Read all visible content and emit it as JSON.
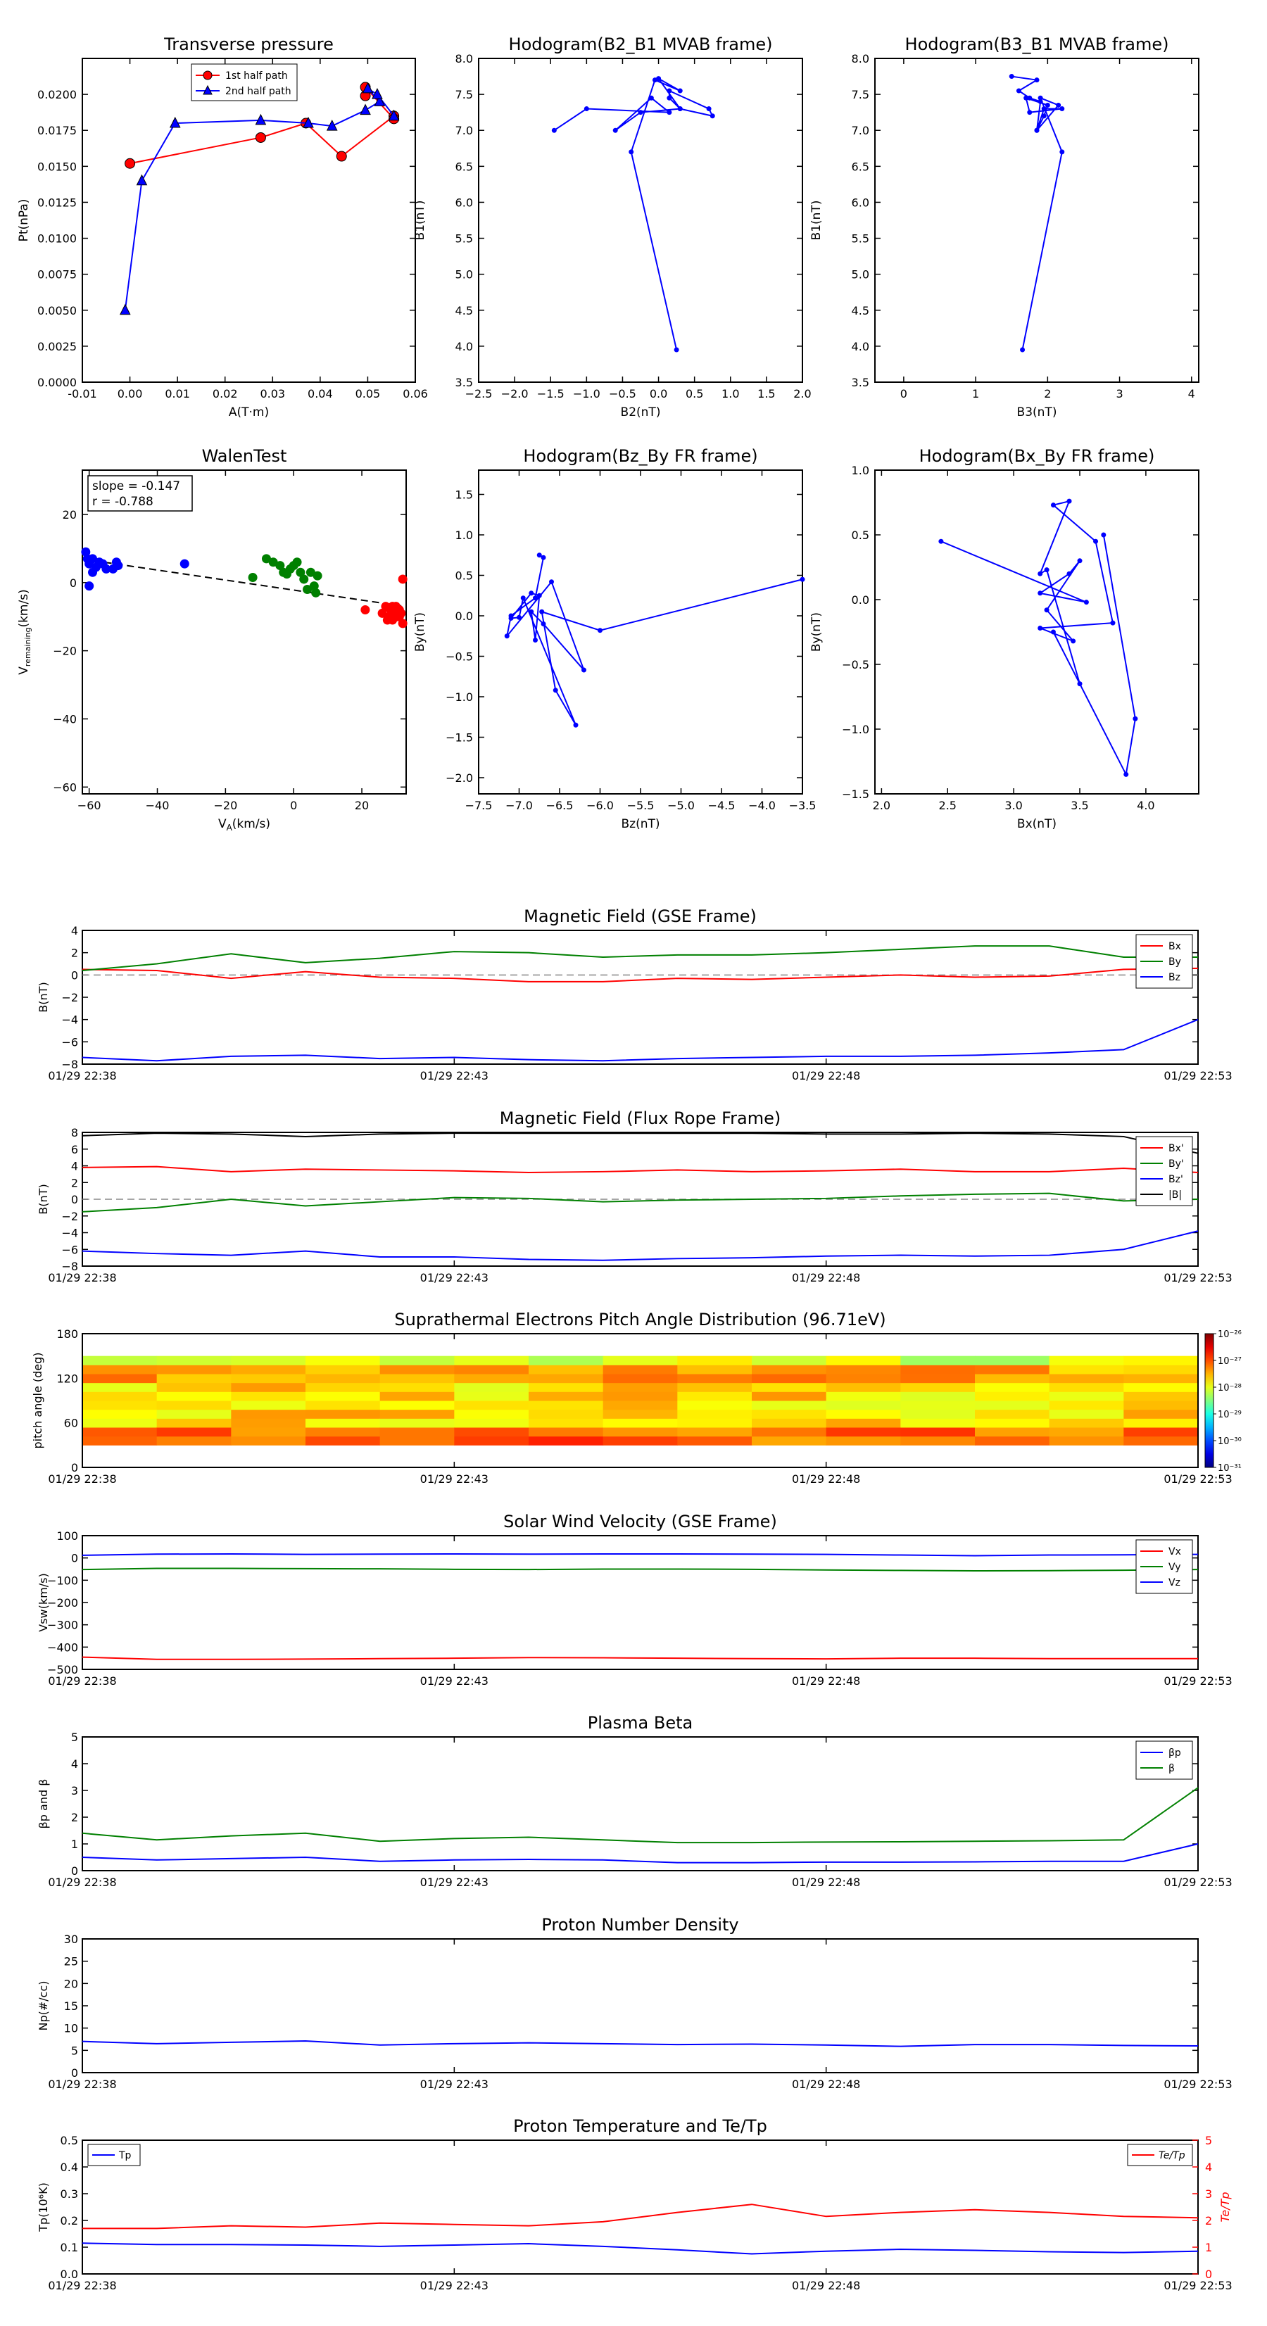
{
  "chart_data": [
    {
      "id": "pt",
      "type": "scatter",
      "title": "Transverse pressure",
      "xlabel": "A(T·m)",
      "ylabel": "Pt(nPa)",
      "xlim": [
        -0.01,
        0.06
      ],
      "ylim": [
        0,
        0.0225
      ],
      "xticks": [
        "-0.01",
        "0.00",
        "0.01",
        "0.02",
        "0.03",
        "0.04",
        "0.05",
        "0.06"
      ],
      "yticks": [
        "0.0000",
        "0.0025",
        "0.0050",
        "0.0075",
        "0.0100",
        "0.0125",
        "0.0150",
        "0.0175",
        "0.0200"
      ],
      "legend": "top-center",
      "series": [
        {
          "name": "1st half path",
          "color": "#ff0000",
          "marker": "circle",
          "x": [
            0.0,
            0.0275,
            0.037,
            0.0445,
            0.0555,
            0.0555,
            0.0495,
            0.0495
          ],
          "y": [
            0.0152,
            0.017,
            0.018,
            0.0157,
            0.0185,
            0.0183,
            0.0205,
            0.0199
          ]
        },
        {
          "name": "2nd half path",
          "color": "#0000ff",
          "marker": "triangle",
          "x": [
            -0.001,
            0.0025,
            0.0095,
            0.0275,
            0.0375,
            0.0425,
            0.0495,
            0.0525,
            0.05,
            0.052,
            0.0555
          ],
          "y": [
            0.005,
            0.014,
            0.018,
            0.0182,
            0.018,
            0.0178,
            0.0189,
            0.0195,
            0.0204,
            0.02,
            0.0185
          ]
        }
      ]
    },
    {
      "id": "hodo21",
      "type": "line",
      "title": "Hodogram(B2_B1 MVAB frame)",
      "xlabel": "B2(nT)",
      "ylabel": "B1(nT)",
      "xlim": [
        -2.5,
        2.0
      ],
      "ylim": [
        3.5,
        8.0
      ],
      "xticks": [
        "−2.5",
        "−2.0",
        "−1.5",
        "−1.0",
        "−0.5",
        "0.0",
        "0.5",
        "1.0",
        "1.5",
        "2.0"
      ],
      "yticks": [
        "3.5",
        "4.0",
        "4.5",
        "5.0",
        "5.5",
        "6.0",
        "6.5",
        "7.0",
        "7.5",
        "8.0"
      ],
      "series": [
        {
          "color": "#0000ff",
          "x": [
            -1.45,
            -1.0,
            0.15,
            -0.1,
            -0.6,
            -0.25,
            0.3,
            0.15,
            0.15,
            0.7,
            0.75,
            0.3,
            0.0,
            0.3,
            -0.05,
            -0.38,
            0.25
          ],
          "y": [
            7.0,
            7.3,
            7.25,
            7.45,
            7.0,
            7.25,
            7.3,
            7.45,
            7.55,
            7.3,
            7.2,
            7.3,
            7.72,
            7.55,
            7.7,
            6.7,
            3.95
          ]
        }
      ]
    },
    {
      "id": "hodo31",
      "type": "line",
      "title": "Hodogram(B3_B1 MVAB frame)",
      "xlabel": "B3(nT)",
      "ylabel": "B1(nT)",
      "xlim": [
        -0.4,
        4.1
      ],
      "ylim": [
        3.5,
        8.0
      ],
      "xticks": [
        "0",
        "1",
        "2",
        "3",
        "4"
      ],
      "yticks": [
        "3.5",
        "4.0",
        "4.5",
        "5.0",
        "5.5",
        "6.0",
        "6.5",
        "7.0",
        "7.5",
        "8.0"
      ],
      "series": [
        {
          "color": "#0000ff",
          "x": [
            1.5,
            1.85,
            1.6,
            1.75,
            1.9,
            1.85,
            1.95,
            2.2,
            1.75,
            1.7,
            2.0,
            1.95,
            1.85,
            2.15,
            1.9,
            2.2,
            1.65
          ],
          "y": [
            7.75,
            7.7,
            7.55,
            7.45,
            7.4,
            7.0,
            7.3,
            7.3,
            7.25,
            7.45,
            7.35,
            7.2,
            7.0,
            7.35,
            7.45,
            6.7,
            3.95
          ]
        }
      ]
    },
    {
      "id": "walen",
      "type": "scatter",
      "title": "WalenTest",
      "xlabel": "V_A(km/s)",
      "ylabel": "V_remaining(km/s)",
      "xlim": [
        -62,
        33
      ],
      "ylim": [
        -62,
        33
      ],
      "xticks": [
        "−60",
        "−40",
        "−20",
        "0",
        "20"
      ],
      "yticks": [
        "−60",
        "−40",
        "−20",
        "0",
        "20"
      ],
      "annotation": [
        "slope = -0.147",
        "r = -0.788"
      ],
      "fit": {
        "slope": -0.147,
        "intercept": -2.2
      },
      "series": [
        {
          "color": "#0000ff",
          "x": [
            -61,
            -60.5,
            -60,
            -59,
            -58,
            -57,
            -56,
            -55,
            -53,
            -52,
            -51.5,
            -60,
            -59,
            -32
          ],
          "y": [
            9,
            7,
            5.5,
            7,
            4.5,
            6,
            5.5,
            4,
            4,
            6,
            5,
            -1,
            3,
            5.5
          ]
        },
        {
          "color": "#008000",
          "x": [
            -12,
            -8,
            -6,
            -4,
            -3,
            -2,
            -1,
            0,
            1,
            2,
            3,
            4,
            5,
            6,
            6.5,
            7
          ],
          "y": [
            1.5,
            7,
            6,
            5,
            3,
            2.5,
            4,
            5,
            6,
            3,
            1,
            -2,
            3,
            -1,
            -3,
            2
          ]
        },
        {
          "color": "#ff0000",
          "x": [
            21,
            26,
            27,
            28,
            28.5,
            29,
            29.5,
            30,
            30.5,
            31,
            31.5,
            32,
            32,
            27.5,
            29,
            31
          ],
          "y": [
            -8,
            -9,
            -7,
            -10,
            -8,
            -11,
            -9,
            -7,
            -10,
            -8,
            -9,
            -12,
            1,
            -11,
            -7,
            -10
          ]
        }
      ]
    },
    {
      "id": "hodo_zy",
      "type": "line",
      "title": "Hodogram(Bz_By FR frame)",
      "xlabel": "Bz(nT)",
      "ylabel": "By(nT)",
      "xlim": [
        -7.5,
        -3.5
      ],
      "ylim": [
        -2.2,
        1.8
      ],
      "xticks": [
        "−7.5",
        "−7.0",
        "−6.5",
        "−6.0",
        "−5.5",
        "−5.0",
        "−4.5",
        "−4.0",
        "−3.5"
      ],
      "yticks": [
        "−2.0",
        "−1.5",
        "−1.0",
        "−0.5",
        "0.0",
        "0.5",
        "1.0",
        "1.5"
      ],
      "series": [
        {
          "color": "#0000ff",
          "x": [
            -3.5,
            -6.0,
            -6.72,
            -6.55,
            -6.3,
            -6.95,
            -7.0,
            -7.1,
            -6.85,
            -6.75,
            -6.8,
            -6.85,
            -6.7,
            -6.2,
            -6.6,
            -7.15,
            -7.1,
            -6.8,
            -6.7,
            -6.75
          ],
          "y": [
            0.45,
            -0.18,
            0.05,
            -0.92,
            -1.35,
            0.22,
            -0.02,
            -0.03,
            0.28,
            0.25,
            -0.3,
            0.05,
            -0.1,
            -0.67,
            0.42,
            -0.25,
            0.0,
            0.22,
            0.72,
            0.75
          ]
        }
      ]
    },
    {
      "id": "hodo_xy",
      "type": "line",
      "title": "Hodogram(Bx_By FR frame)",
      "xlabel": "Bx(nT)",
      "ylabel": "By(nT)",
      "xlim": [
        1.95,
        4.4
      ],
      "ylim": [
        -1.5,
        1.0
      ],
      "xticks": [
        "2.0",
        "2.5",
        "3.0",
        "3.5",
        "4.0"
      ],
      "yticks": [
        "−1.5",
        "−1.0",
        "−0.5",
        "0.0",
        "0.5",
        "1.0"
      ],
      "series": [
        {
          "color": "#0000ff",
          "x": [
            2.45,
            3.55,
            3.2,
            3.42,
            3.5,
            3.25,
            3.45,
            3.2,
            3.75,
            3.62,
            3.3,
            3.42,
            3.2,
            3.25,
            3.5,
            3.3,
            3.85,
            3.92,
            3.68
          ],
          "y": [
            0.45,
            -0.02,
            0.05,
            0.2,
            0.3,
            -0.08,
            -0.32,
            -0.22,
            -0.18,
            0.45,
            0.73,
            0.76,
            0.2,
            0.23,
            -0.65,
            -0.25,
            -1.35,
            -0.92,
            0.5
          ]
        }
      ]
    },
    {
      "id": "bgse",
      "type": "line",
      "title": "Magnetic Field (GSE Frame)",
      "ylabel": "B(nT)",
      "xticks": [
        "01/29 22:38",
        "01/29 22:43",
        "01/29 22:48",
        "01/29 22:53"
      ],
      "ylim": [
        -8,
        4
      ],
      "yticks": [
        "−8",
        "−6",
        "−4",
        "−2",
        "0",
        "2",
        "4"
      ],
      "legend": "top-right",
      "zero_line": true,
      "series": [
        {
          "name": "Bx",
          "color": "#ff0000",
          "y": [
            0.5,
            0.4,
            -0.3,
            0.3,
            -0.2,
            -0.3,
            -0.6,
            -0.6,
            -0.3,
            -0.4,
            -0.2,
            0.0,
            -0.2,
            -0.1,
            0.5,
            0.6
          ]
        },
        {
          "name": "By",
          "color": "#008000",
          "y": [
            0.4,
            1.0,
            1.9,
            1.1,
            1.5,
            2.1,
            2.0,
            1.6,
            1.8,
            1.8,
            2.0,
            2.3,
            2.6,
            2.6,
            1.6,
            1.6
          ]
        },
        {
          "name": "Bz",
          "color": "#0000ff",
          "y": [
            -7.4,
            -7.7,
            -7.3,
            -7.2,
            -7.5,
            -7.4,
            -7.6,
            -7.7,
            -7.5,
            -7.4,
            -7.3,
            -7.3,
            -7.2,
            -7.0,
            -6.7,
            -4.0
          ]
        }
      ]
    },
    {
      "id": "bfr",
      "type": "line",
      "title": "Magnetic Field (Flux Rope Frame)",
      "ylabel": "B(nT)",
      "xticks": [
        "01/29 22:38",
        "01/29 22:43",
        "01/29 22:48",
        "01/29 22:53"
      ],
      "ylim": [
        -8,
        8
      ],
      "yticks": [
        "−8",
        "−6",
        "−4",
        "−2",
        "0",
        "2",
        "4",
        "6",
        "8"
      ],
      "legend": "top-right",
      "zero_line": true,
      "series": [
        {
          "name": "Bx'",
          "color": "#ff0000",
          "y": [
            3.8,
            3.9,
            3.3,
            3.6,
            3.5,
            3.4,
            3.2,
            3.3,
            3.5,
            3.3,
            3.4,
            3.6,
            3.3,
            3.3,
            3.7,
            3.2
          ]
        },
        {
          "name": "By'",
          "color": "#008000",
          "y": [
            -1.5,
            -1.0,
            0.0,
            -0.8,
            -0.3,
            0.2,
            0.1,
            -0.3,
            -0.1,
            0.0,
            0.1,
            0.4,
            0.6,
            0.7,
            -0.2,
            0.0
          ]
        },
        {
          "name": "Bz'",
          "color": "#0000ff",
          "y": [
            -6.2,
            -6.5,
            -6.7,
            -6.2,
            -6.9,
            -6.9,
            -7.2,
            -7.3,
            -7.1,
            -7.0,
            -6.8,
            -6.7,
            -6.8,
            -6.7,
            -6.0,
            -3.8
          ]
        },
        {
          "name": "|B|",
          "color": "#000000",
          "y": [
            7.6,
            7.9,
            7.8,
            7.5,
            7.8,
            7.9,
            7.9,
            7.9,
            7.9,
            7.9,
            7.8,
            7.8,
            7.9,
            7.8,
            7.5,
            5.5
          ]
        }
      ]
    },
    {
      "id": "pad",
      "type": "heatmap",
      "title": "Suprathermal Electrons Pitch Angle Distribution (96.71eV)",
      "ylabel": "pitch angle (deg)",
      "xticks": [
        "01/29 22:38",
        "01/29 22:43",
        "01/29 22:48",
        "01/29 22:53"
      ],
      "ylim": [
        0,
        180
      ],
      "yticks": [
        "0",
        "60",
        "120",
        "180"
      ],
      "colorbar_ticks": [
        "10⁻³¹",
        "10⁻³⁰",
        "10⁻²⁹",
        "10⁻²⁸",
        "10⁻²⁷",
        "10⁻²⁶"
      ],
      "colorbar_range_log10": [
        -31,
        -26
      ]
    },
    {
      "id": "vsw",
      "type": "line",
      "title": "Solar Wind Velocity (GSE Frame)",
      "ylabel": "Vsw(km/s)",
      "xticks": [
        "01/29 22:38",
        "01/29 22:43",
        "01/29 22:48",
        "01/29 22:53"
      ],
      "ylim": [
        -500,
        100
      ],
      "yticks": [
        "−500",
        "−400",
        "−300",
        "−200",
        "−100",
        "0",
        "100"
      ],
      "legend": "top-right",
      "series": [
        {
          "name": "Vx",
          "color": "#ff0000",
          "y": [
            -445,
            -455,
            -455,
            -454,
            -452,
            -450,
            -447,
            -448,
            -450,
            -452,
            -453,
            -450,
            -450,
            -452,
            -452,
            -452
          ]
        },
        {
          "name": "Vy",
          "color": "#008000",
          "y": [
            -52,
            -47,
            -47,
            -48,
            -49,
            -51,
            -52,
            -50,
            -50,
            -51,
            -54,
            -56,
            -58,
            -57,
            -55,
            -52
          ]
        },
        {
          "name": "Vz",
          "color": "#0000ff",
          "y": [
            12,
            17,
            18,
            16,
            17,
            18,
            17,
            18,
            18,
            17,
            16,
            13,
            10,
            13,
            14,
            16
          ]
        }
      ]
    },
    {
      "id": "beta",
      "type": "line",
      "title": "Plasma Beta",
      "ylabel": "βp and β",
      "xticks": [
        "01/29 22:38",
        "01/29 22:43",
        "01/29 22:48",
        "01/29 22:53"
      ],
      "ylim": [
        0,
        5
      ],
      "yticks": [
        "0",
        "1",
        "2",
        "3",
        "4",
        "5"
      ],
      "legend": "top-right",
      "series": [
        {
          "name": "βp",
          "color": "#0000ff",
          "y": [
            0.5,
            0.4,
            0.45,
            0.5,
            0.35,
            0.4,
            0.42,
            0.4,
            0.3,
            0.3,
            0.32,
            0.32,
            0.33,
            0.35,
            0.35,
            1.0
          ]
        },
        {
          "name": "β",
          "color": "#008000",
          "y": [
            1.4,
            1.15,
            1.3,
            1.4,
            1.1,
            1.2,
            1.25,
            1.15,
            1.05,
            1.05,
            1.07,
            1.08,
            1.1,
            1.12,
            1.15,
            3.1
          ]
        }
      ]
    },
    {
      "id": "np",
      "type": "line",
      "title": "Proton Number Density",
      "ylabel": "Np(#/cc)",
      "xticks": [
        "01/29 22:38",
        "01/29 22:43",
        "01/29 22:48",
        "01/29 22:53"
      ],
      "ylim": [
        0,
        30
      ],
      "yticks": [
        "0",
        "5",
        "10",
        "15",
        "20",
        "25",
        "30"
      ],
      "series": [
        {
          "color": "#0000ff",
          "y": [
            7.0,
            6.5,
            6.8,
            7.1,
            6.2,
            6.5,
            6.7,
            6.5,
            6.3,
            6.4,
            6.2,
            5.9,
            6.3,
            6.3,
            6.1,
            6.0
          ]
        }
      ]
    },
    {
      "id": "tp",
      "type": "line",
      "title": "Proton Temperature and Te/Tp",
      "ylabel": "Tp(10⁶K)",
      "ylabel_right": "Te/Tp",
      "xticks": [
        "01/29 22:38",
        "01/29 22:43",
        "01/29 22:48",
        "01/29 22:53"
      ],
      "ylim": [
        0,
        0.5
      ],
      "yticks": [
        "0.0",
        "0.1",
        "0.2",
        "0.3",
        "0.4",
        "0.5"
      ],
      "ylim_right": [
        0,
        5
      ],
      "yticks_right": [
        "0",
        "1",
        "2",
        "3",
        "4",
        "5"
      ],
      "series": [
        {
          "name": "Tp",
          "color": "#0000ff",
          "axis": "left",
          "y": [
            0.115,
            0.11,
            0.11,
            0.108,
            0.103,
            0.108,
            0.113,
            0.103,
            0.09,
            0.075,
            0.085,
            0.092,
            0.088,
            0.083,
            0.08,
            0.085
          ]
        },
        {
          "name": "Te/Tp",
          "color": "#ff0000",
          "axis": "right",
          "y": [
            1.7,
            1.7,
            1.8,
            1.75,
            1.9,
            1.85,
            1.8,
            1.95,
            2.3,
            2.6,
            2.15,
            2.3,
            2.4,
            2.3,
            2.15,
            2.1
          ]
        }
      ]
    }
  ]
}
